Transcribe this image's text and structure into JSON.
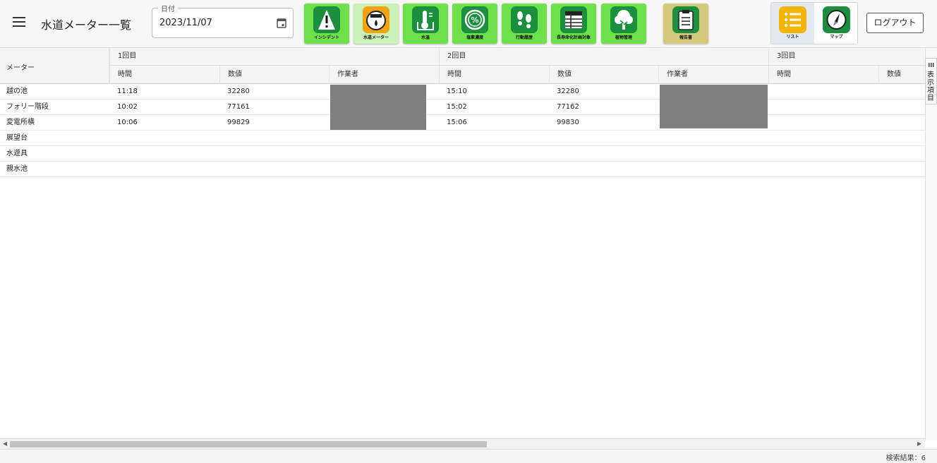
{
  "header": {
    "title": "水道メーター一覧",
    "date_label": "日付",
    "date_value": "2023/11/07",
    "logout_label": "ログアウト"
  },
  "nav": [
    {
      "id": "incident",
      "label": "インシデント",
      "icon": "warning-icon"
    },
    {
      "id": "water-meter",
      "label": "水道メーター",
      "icon": "meter-icon",
      "active": true
    },
    {
      "id": "water-temp",
      "label": "水温",
      "icon": "thermometer-icon"
    },
    {
      "id": "salinity",
      "label": "塩素濃度",
      "icon": "percent-icon"
    },
    {
      "id": "activity",
      "label": "行動履歴",
      "icon": "footprints-icon"
    },
    {
      "id": "target",
      "label": "長寿命化計画対象",
      "icon": "table-icon"
    },
    {
      "id": "plants",
      "label": "植物管理",
      "icon": "tree-icon"
    },
    {
      "id": "report",
      "label": "報告書",
      "icon": "clipboard-icon"
    }
  ],
  "view_toggle": [
    {
      "label": "リスト",
      "icon": "list-icon",
      "active": true
    },
    {
      "label": "マップ",
      "icon": "compass-icon"
    }
  ],
  "table": {
    "meter_header": "メーター",
    "groups": [
      "1回目",
      "2回目",
      "3回目"
    ],
    "sub_headers": [
      "時間",
      "数値",
      "作業者",
      "時間",
      "数値",
      "作業者",
      "時間",
      "数値"
    ],
    "rows": [
      {
        "name": "越の池",
        "c1_time": "11:18",
        "c1_value": "32280",
        "c2_time": "15:10",
        "c2_value": "32280"
      },
      {
        "name": "フォリー階段",
        "c1_time": "10:02",
        "c1_value": "77161",
        "c2_time": "15:02",
        "c2_value": "77162"
      },
      {
        "name": "変電所横",
        "c1_time": "10:06",
        "c1_value": "99829",
        "c2_time": "15:06",
        "c2_value": "99830"
      },
      {
        "name": "展望台",
        "c1_time": "",
        "c1_value": "",
        "c2_time": "",
        "c2_value": ""
      },
      {
        "name": "水遊具",
        "c1_time": "",
        "c1_value": "",
        "c2_time": "",
        "c2_value": ""
      },
      {
        "name": "親水池",
        "c1_time": "",
        "c1_value": "",
        "c2_time": "",
        "c2_value": ""
      }
    ]
  },
  "side_tab_label": "表示項目",
  "footer": {
    "result_count": "検索結果：6"
  }
}
